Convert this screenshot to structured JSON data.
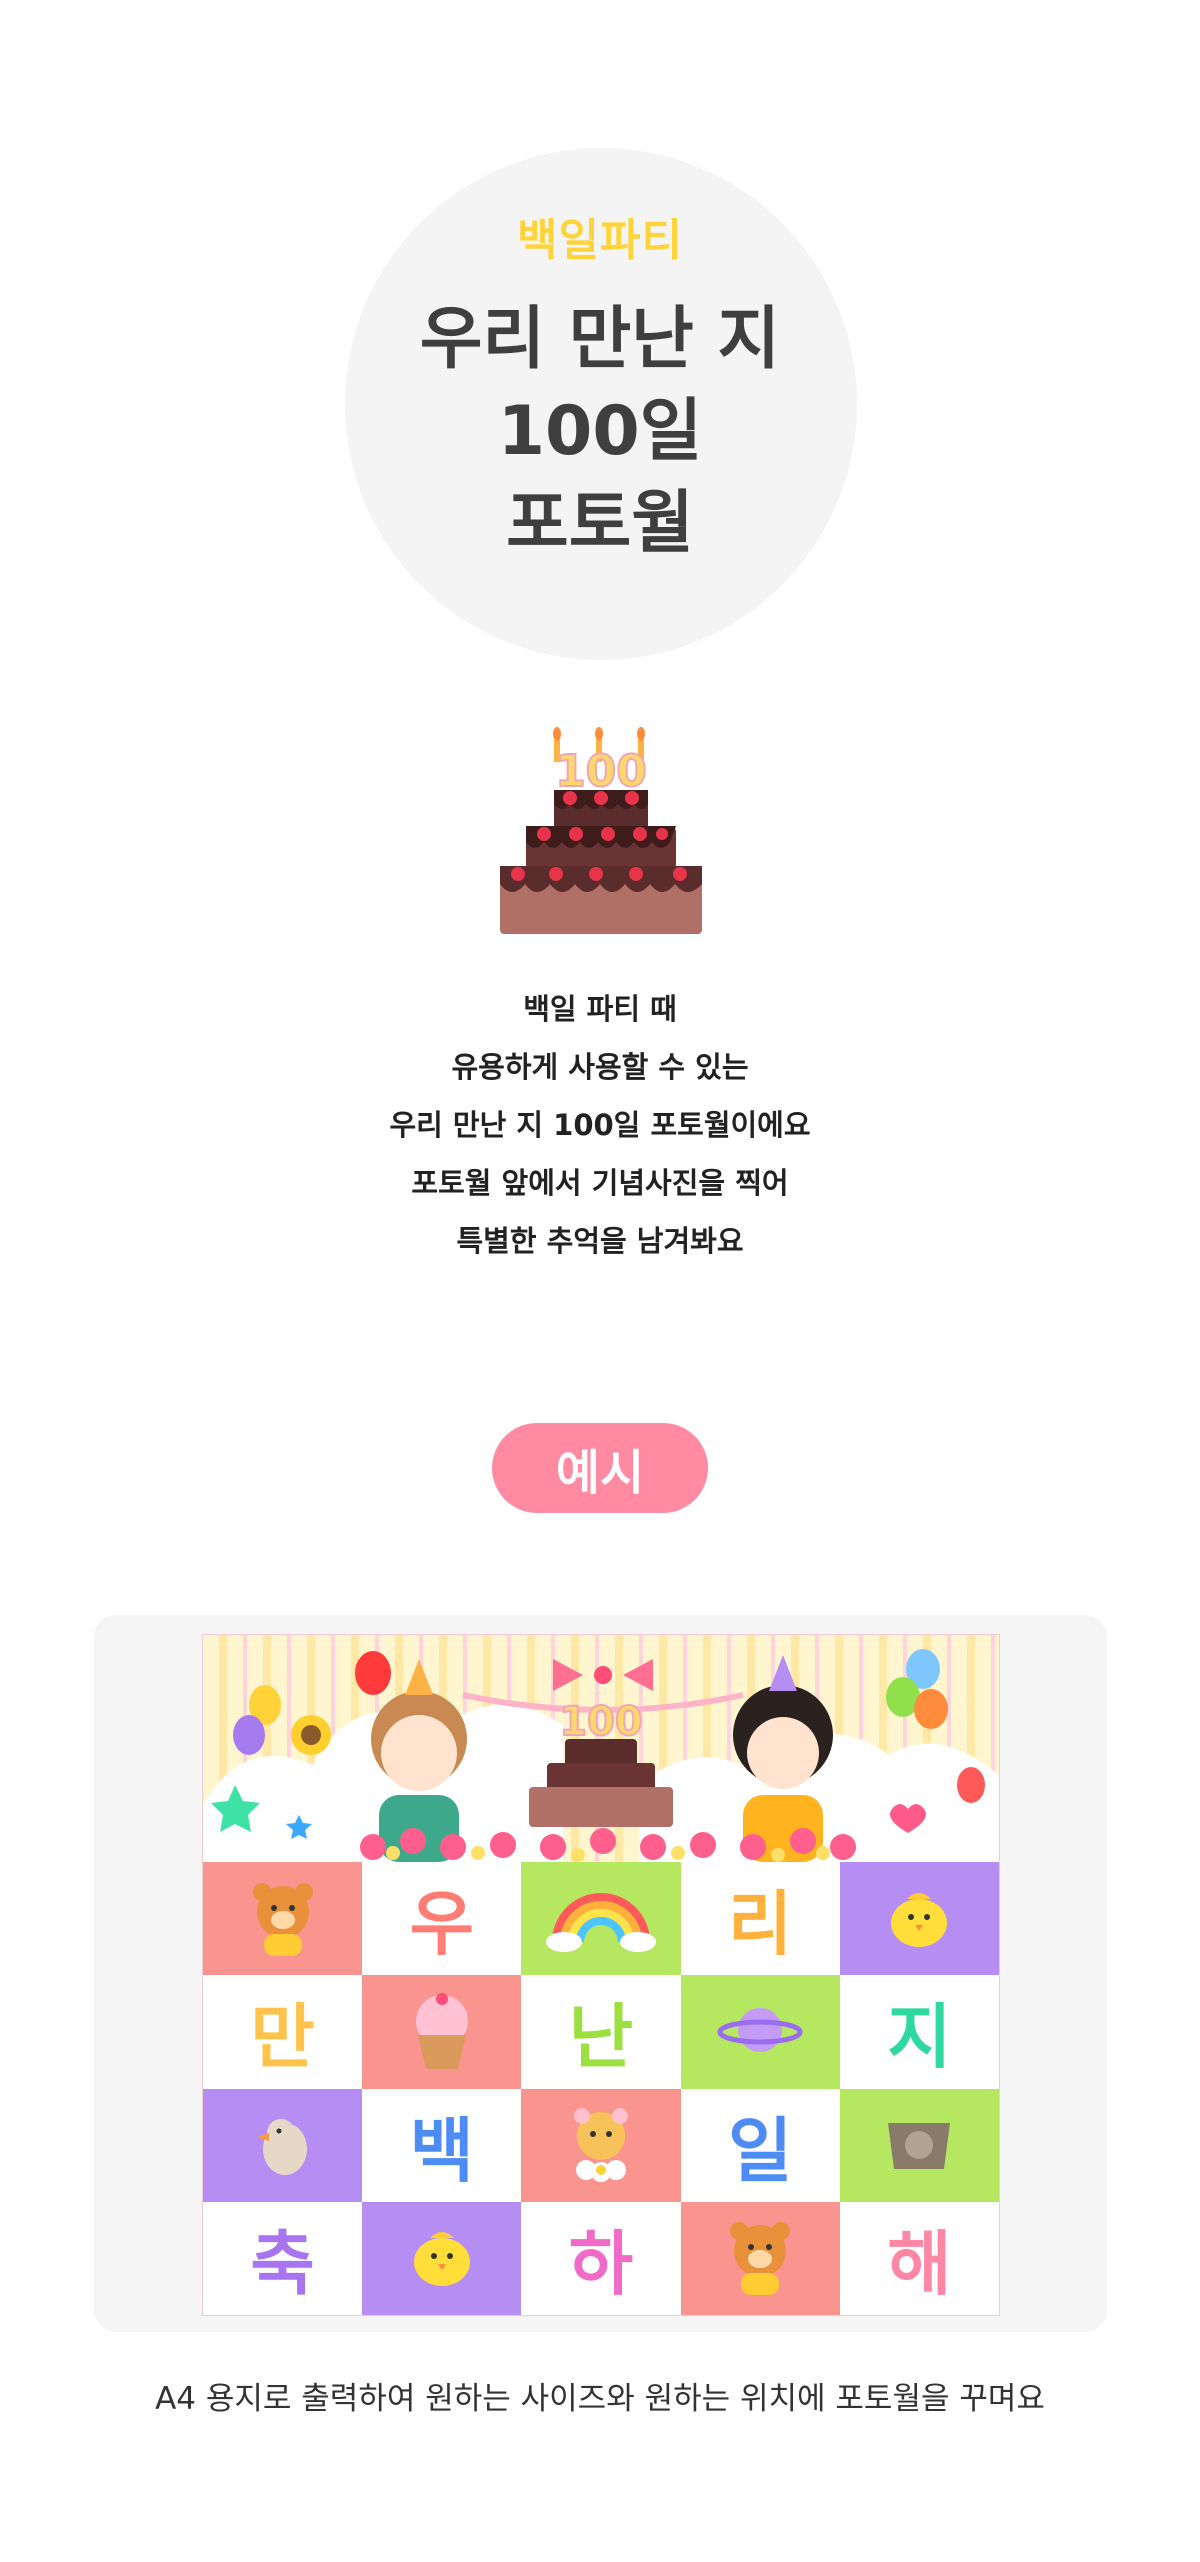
{
  "hero": {
    "eyebrow": "백일파티",
    "title_lines": [
      "우리 만난 지",
      "100일",
      "포토월"
    ]
  },
  "cake": {
    "candle_number": "100"
  },
  "description": [
    "백일 파티 때",
    "유용하게 사용할 수 있는",
    "우리 만난 지 100일 포토월이에요",
    "포토월 앞에서 기념사진을 찍어",
    "특별한 추억을 남겨봐요"
  ],
  "example_button": {
    "label": "예시"
  },
  "poster": {
    "cake_number": "100",
    "cells": [
      {
        "kind": "icon",
        "icon": "bear-icon",
        "bg": "#f9948f"
      },
      {
        "kind": "letter",
        "text": "우",
        "bg": "#ffffff",
        "color": "#ff7d73"
      },
      {
        "kind": "icon",
        "icon": "rainbow-icon",
        "bg": "#b5e860"
      },
      {
        "kind": "letter",
        "text": "리",
        "bg": "#ffffff",
        "color": "#ffb13b"
      },
      {
        "kind": "icon",
        "icon": "chick-icon",
        "bg": "#b68df2"
      },
      {
        "kind": "letter",
        "text": "만",
        "bg": "#ffffff",
        "color": "#ffc24a"
      },
      {
        "kind": "icon",
        "icon": "cupcake-icon",
        "bg": "#f9948f"
      },
      {
        "kind": "letter",
        "text": "난",
        "bg": "#ffffff",
        "color": "#9be03f"
      },
      {
        "kind": "icon",
        "icon": "planet-icon",
        "bg": "#b5e860"
      },
      {
        "kind": "letter",
        "text": "지",
        "bg": "#ffffff",
        "color": "#2fd8a0"
      },
      {
        "kind": "icon",
        "icon": "bird-icon",
        "bg": "#b68df2"
      },
      {
        "kind": "letter",
        "text": "백",
        "bg": "#ffffff",
        "color": "#4d8cf5"
      },
      {
        "kind": "icon",
        "icon": "hamster-icon",
        "bg": "#f9948f"
      },
      {
        "kind": "letter",
        "text": "일",
        "bg": "#ffffff",
        "color": "#4d8cf5"
      },
      {
        "kind": "icon",
        "icon": "squirrel-icon",
        "bg": "#b5e860"
      },
      {
        "kind": "letter",
        "text": "축",
        "bg": "#ffffff",
        "color": "#a874f0"
      },
      {
        "kind": "icon",
        "icon": "chick-icon",
        "bg": "#b68df2"
      },
      {
        "kind": "letter",
        "text": "하",
        "bg": "#ffffff",
        "color": "#f26ac8"
      },
      {
        "kind": "icon",
        "icon": "bear-icon",
        "bg": "#f9948f"
      },
      {
        "kind": "letter",
        "text": "해",
        "bg": "#ffffff",
        "color": "#ff87a6"
      }
    ]
  },
  "footnote": "A4 용지로 출력하여 원하는 사이즈와 원하는 위치에 포토월을 꾸며요"
}
